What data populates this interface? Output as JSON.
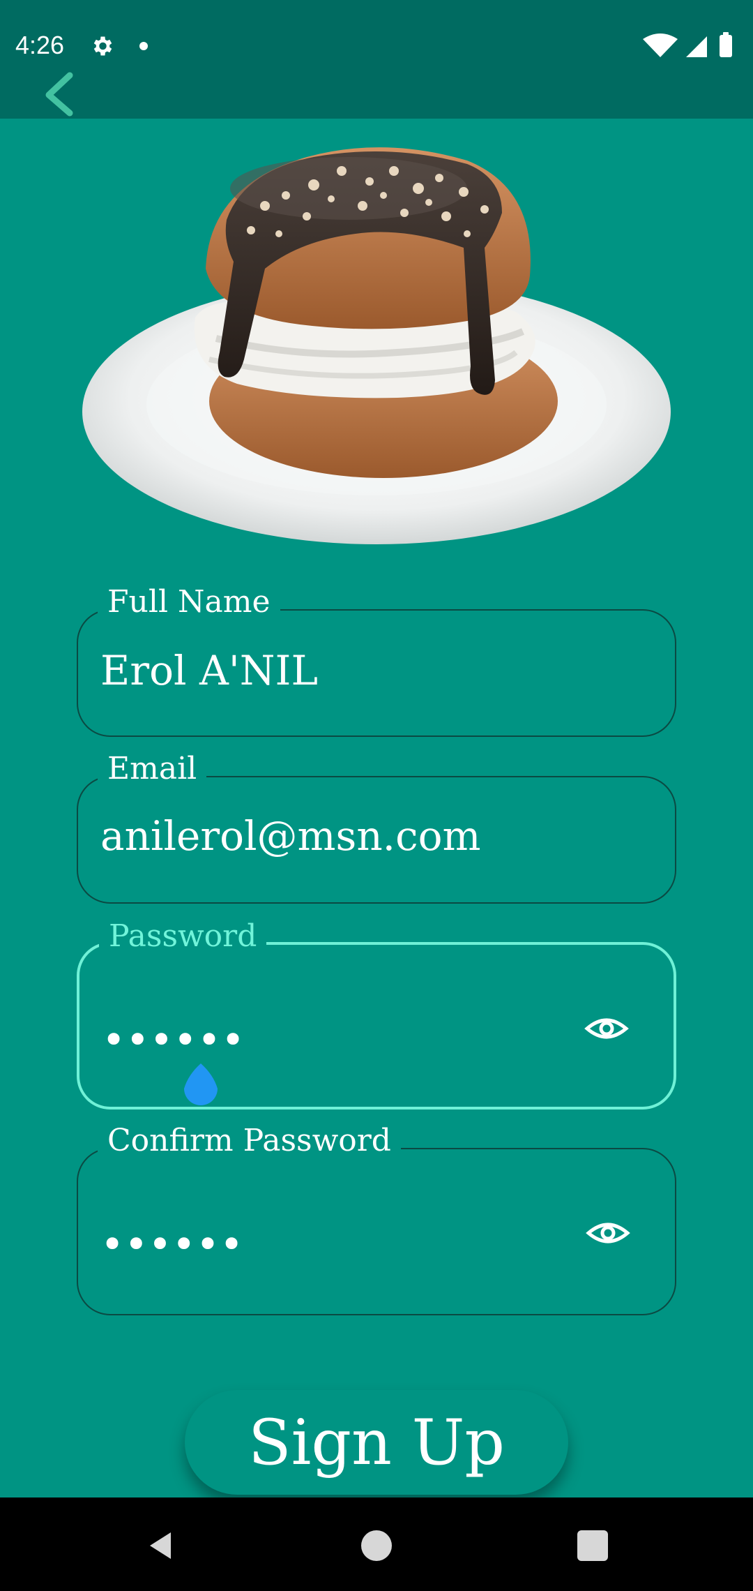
{
  "status_bar": {
    "time": "4:26"
  },
  "form": {
    "full_name": {
      "label": "Full Name",
      "value": "Erol A'NIL"
    },
    "email": {
      "label": "Email",
      "value": "anilerol@msn.com"
    },
    "password": {
      "label": "Password",
      "value": "••••••",
      "active": true
    },
    "confirm_password": {
      "label": "Confirm Password",
      "value": "••••••"
    }
  },
  "signup_button": {
    "label": "Sign Up"
  },
  "colors": {
    "background": "#009483",
    "topbar": "#006b61",
    "active_outline": "#6ff1d7",
    "inactive_outline": "#0b4a43",
    "cursor": "#2196f3"
  },
  "icons": {
    "eye": "eye-icon",
    "back": "chevron-left-icon"
  }
}
